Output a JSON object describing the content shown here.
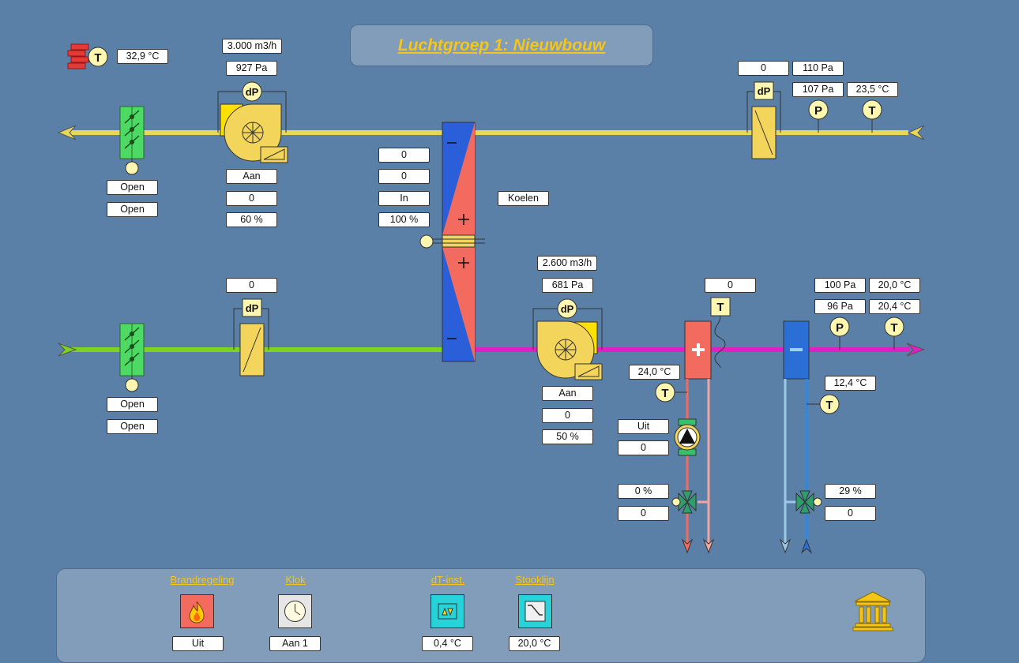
{
  "title": "Luchtgroep 1: Nieuwbouw",
  "colors": {
    "background": "#5b80a7",
    "panel": "#819db9",
    "title": "#f5c518",
    "exhaust_duct": "#e8d85a",
    "supply_fresh": "#7ed321",
    "supply_heated": "#e020c0",
    "hx_cold": "#2b5fd9",
    "hx_warm": "#f26b5e",
    "heating_coil": "#f26b5e",
    "cooling_coil": "#2b6fd6"
  },
  "exhaust": {
    "outdoor_temp_icon": "T",
    "outdoor_temp": "32,9 °C",
    "damper_state_1": "Open",
    "damper_state_2": "Open",
    "fan_flow": "3.000 m3/h",
    "fan_pressure": "927 Pa",
    "fan_dp_icon": "dP",
    "fan_status": "Aan",
    "fan_value": "0",
    "fan_speed": "60 %",
    "filter_value": "0",
    "filter_pressure": "110 Pa",
    "filter_dp_icon": "dP",
    "duct_pressure": "107 Pa",
    "duct_temp": "23,5 °C",
    "duct_p_icon": "P",
    "duct_t_icon": "T"
  },
  "heat_exchanger": {
    "val1": "0",
    "val2": "0",
    "mode": "In",
    "percent": "100 %",
    "status": "Koelen"
  },
  "supply": {
    "damper_state_1": "Open",
    "damper_state_2": "Open",
    "filter_value": "0",
    "filter_dp_icon": "dP",
    "fan_flow": "2.600 m3/h",
    "fan_pressure": "681 Pa",
    "fan_dp_icon": "dP",
    "fan_status": "Aan",
    "fan_value": "0",
    "fan_speed": "50 %",
    "frost_value": "0",
    "frost_icon": "T",
    "pressure_1": "100 Pa",
    "temp_1": "20,0 °C",
    "pressure_2": "96 Pa",
    "temp_2": "20,4 °C",
    "p_icon": "P",
    "t_icon": "T"
  },
  "heating": {
    "return_temp": "24,0 °C",
    "t_icon": "T",
    "pump_status": "Uit",
    "pump_value": "0",
    "valve_percent": "0 %",
    "valve_value": "0"
  },
  "cooling": {
    "return_temp": "12,4 °C",
    "t_icon": "T",
    "valve_percent": "29 %",
    "valve_value": "0"
  },
  "footer": {
    "items": [
      {
        "label": "Brandregeling",
        "value": "Uit",
        "icon": "fire-icon"
      },
      {
        "label": "Klok",
        "value": "Aan 1",
        "icon": "clock-icon"
      },
      {
        "label": "dT-inst.",
        "value": "0,4 °C",
        "icon": "delta-t-icon"
      },
      {
        "label": "Stooklijn",
        "value": "20,0 °C",
        "icon": "heating-curve-icon"
      }
    ],
    "home_icon": "building-icon"
  }
}
